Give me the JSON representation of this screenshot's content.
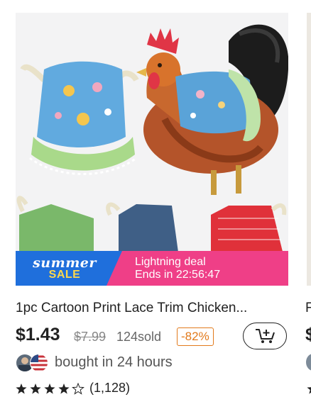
{
  "product": {
    "title": "1pc Cartoon Print Lace Trim Chicken...",
    "price": "$1.43",
    "original_price": "$7.99",
    "sold": "124sold",
    "discount": "-82%",
    "social_proof": "bought in 24 hours",
    "rating": {
      "stars": 4.5,
      "count": "(1,128)"
    }
  },
  "promo": {
    "badge_line1": "summer",
    "badge_line2": "SALE",
    "deal_title": "Lightning deal",
    "deal_timer": "Ends in 22:56:47"
  },
  "next_card": {
    "title_first_char": "F",
    "price_first_char": "$"
  },
  "icons": [
    "add-to-cart-icon",
    "star-icon",
    "half-star-icon"
  ],
  "colors": {
    "promo_blue": "#1f6fdc",
    "promo_pink": "#ef3f87",
    "sale_yellow": "#ffd84a",
    "discount_orange": "#e27a1c"
  }
}
